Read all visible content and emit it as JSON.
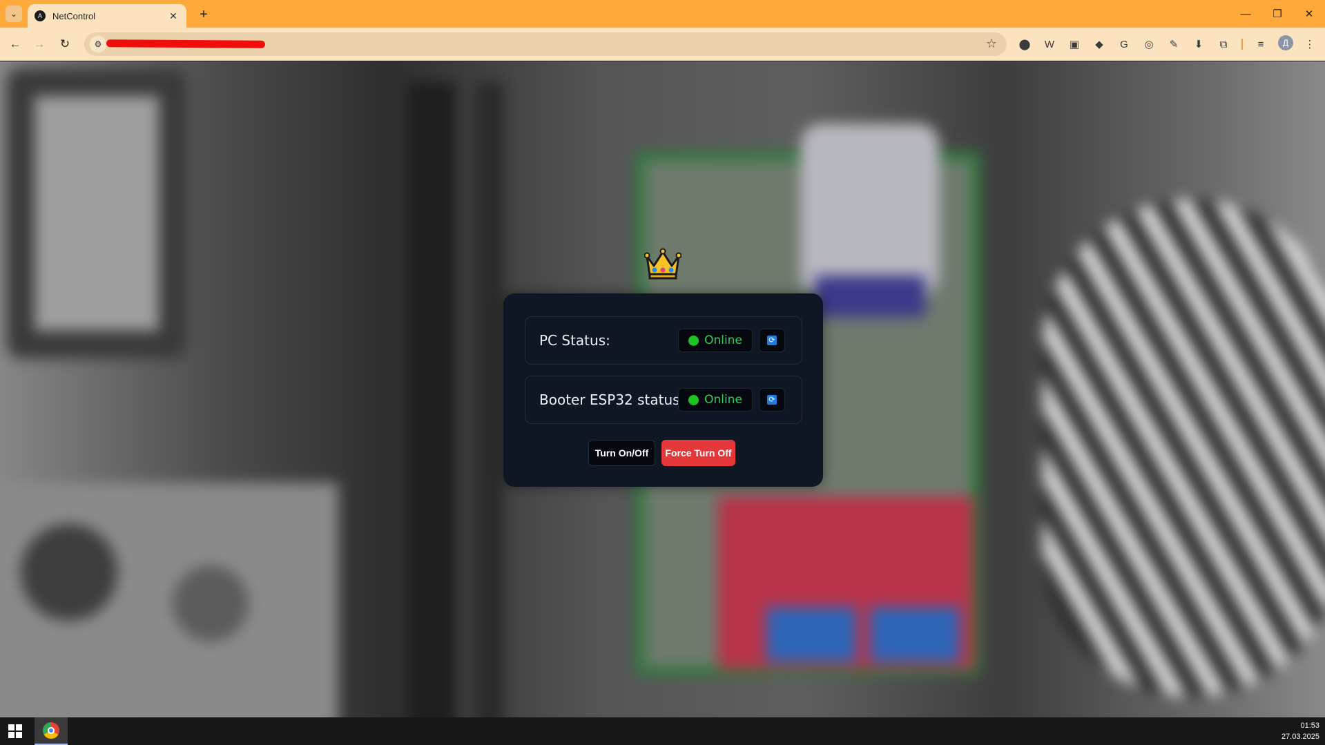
{
  "browser": {
    "tab_title": "NetControl",
    "tab_favicon": "A",
    "new_tab_label": "+",
    "avatar_letter": "Д",
    "accent_color": "#ffa93a",
    "toolbar_color": "#fbe3bf"
  },
  "extensions": [
    {
      "name": "circle-extension-icon",
      "glyph": "⬤"
    },
    {
      "name": "w-extension-icon",
      "glyph": "W"
    },
    {
      "name": "translate-extension-icon",
      "glyph": "▣"
    },
    {
      "name": "hat-extension-icon",
      "glyph": "◆"
    },
    {
      "name": "google-translate-icon",
      "glyph": "G"
    },
    {
      "name": "camera-extension-icon",
      "glyph": "◎"
    },
    {
      "name": "eyedropper-extension-icon",
      "glyph": "✎"
    },
    {
      "name": "download-extension-icon",
      "glyph": "⬇"
    },
    {
      "name": "puzzle-extensions-icon",
      "glyph": "⧉"
    }
  ],
  "app": {
    "crown_emoji": "👑",
    "statuses": [
      {
        "label": "PC Status:",
        "state": "Online",
        "state_color": "#34d058"
      },
      {
        "label": "Booter ESP32 status:",
        "state": "Online",
        "state_color": "#34d058"
      }
    ],
    "turn_button": "Turn On/Off",
    "force_button": "Force Turn Off",
    "force_color": "#e5383b"
  },
  "taskbar": {
    "time": "01:53",
    "date": "27.03.2025"
  }
}
